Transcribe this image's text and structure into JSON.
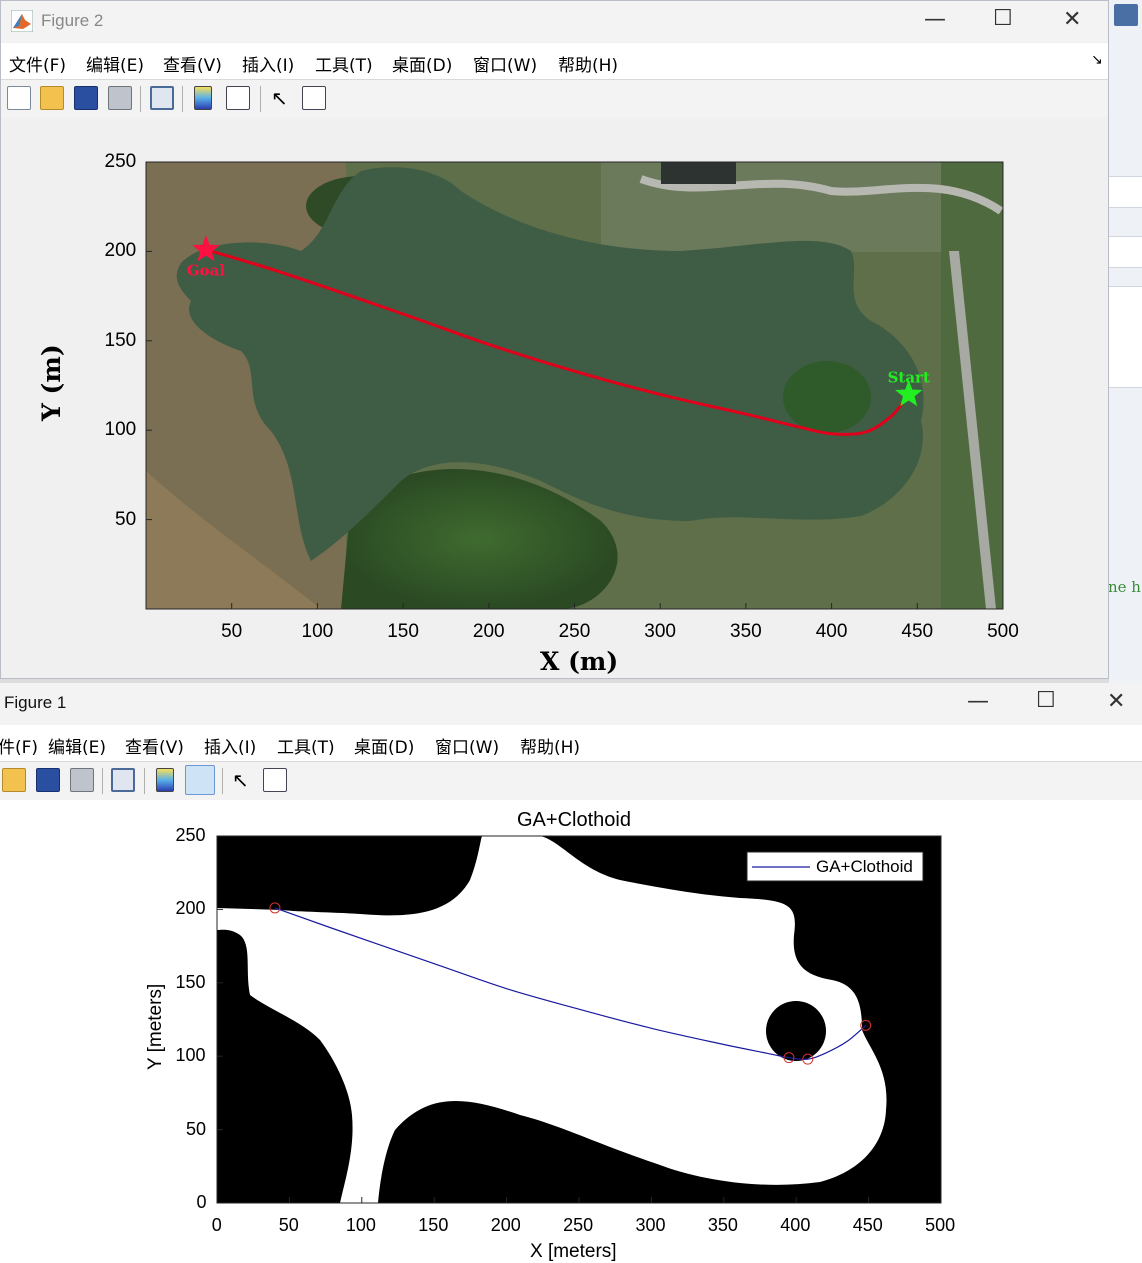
{
  "background_window": {
    "snippet": "ne h"
  },
  "figure2": {
    "title": "Figure 2",
    "menu": [
      "文件(F)",
      "编辑(E)",
      "查看(V)",
      "插入(I)",
      "工具(T)",
      "桌面(D)",
      "窗口(W)",
      "帮助(H)"
    ],
    "toolbar_icons": [
      "new-file-icon",
      "open-folder-icon",
      "save-icon",
      "print-icon",
      "link-plot-icon",
      "colorbar-icon",
      "legend-icon",
      "pointer-icon",
      "property-inspector-icon"
    ],
    "axes_toolbar_icons": [
      "brush-icon",
      "data-tips-icon",
      "rotate-icon",
      "pan-icon",
      "zoom-in-icon",
      "zoom-out-icon",
      "home-icon"
    ],
    "chart_data": {
      "type": "line",
      "xlabel": "X (m)",
      "ylabel": "Y (m)",
      "xlim": [
        0,
        500
      ],
      "ylim": [
        0,
        250
      ],
      "xticks": [
        "50",
        "100",
        "150",
        "200",
        "250",
        "300",
        "350",
        "400",
        "450",
        "500"
      ],
      "yticks": [
        "50",
        "100",
        "150",
        "200",
        "250"
      ],
      "background": "satellite image of a lake",
      "series": [
        {
          "color": "#e0001b",
          "x": [
            35,
            80,
            150,
            200,
            250,
            300,
            350,
            380,
            400,
            420,
            435,
            445
          ],
          "y": [
            201,
            188,
            165,
            148,
            133,
            120,
            109,
            102,
            98,
            99,
            108,
            120
          ]
        }
      ],
      "markers": [
        {
          "label": "Goal",
          "x": 35,
          "y": 201,
          "shape": "star",
          "color": "#ff1040"
        },
        {
          "label": "Start",
          "x": 445,
          "y": 120,
          "shape": "star",
          "color": "#22ee22"
        }
      ]
    }
  },
  "figure1": {
    "title": "Figure 1",
    "menu": [
      "件(F)",
      "编辑(E)",
      "查看(V)",
      "插入(I)",
      "工具(T)",
      "桌面(D)",
      "窗口(W)",
      "帮助(H)"
    ],
    "toolbar_icons": [
      "open-folder-icon",
      "save-icon",
      "print-icon",
      "link-plot-icon",
      "colorbar-icon",
      "legend-icon",
      "pointer-icon",
      "property-inspector-icon"
    ],
    "chart_data": {
      "type": "line",
      "title": "GA+Clothoid",
      "xlabel": "X [meters]",
      "ylabel": "Y [meters]",
      "xlim": [
        0,
        500
      ],
      "ylim": [
        0,
        250
      ],
      "xticks": [
        "0",
        "50",
        "100",
        "150",
        "200",
        "250",
        "300",
        "350",
        "400",
        "450",
        "500"
      ],
      "yticks": [
        "0",
        "50",
        "100",
        "150",
        "200",
        "250"
      ],
      "legend": "top-right",
      "background": "binary occupancy map (white = free water, black = obstacles)",
      "series": [
        {
          "name": "GA+Clothoid",
          "color": "#1a1aa0",
          "x": [
            40,
            80,
            150,
            200,
            250,
            300,
            350,
            380,
            395,
            408,
            420,
            435,
            448
          ],
          "y": [
            201,
            187,
            163,
            146,
            132,
            119,
            108,
            102,
            99,
            98,
            102,
            110,
            121
          ]
        }
      ],
      "waypoints": {
        "color": "#d03030",
        "x": [
          40,
          395,
          408,
          448
        ],
        "y": [
          201,
          99,
          98,
          121
        ]
      }
    }
  }
}
